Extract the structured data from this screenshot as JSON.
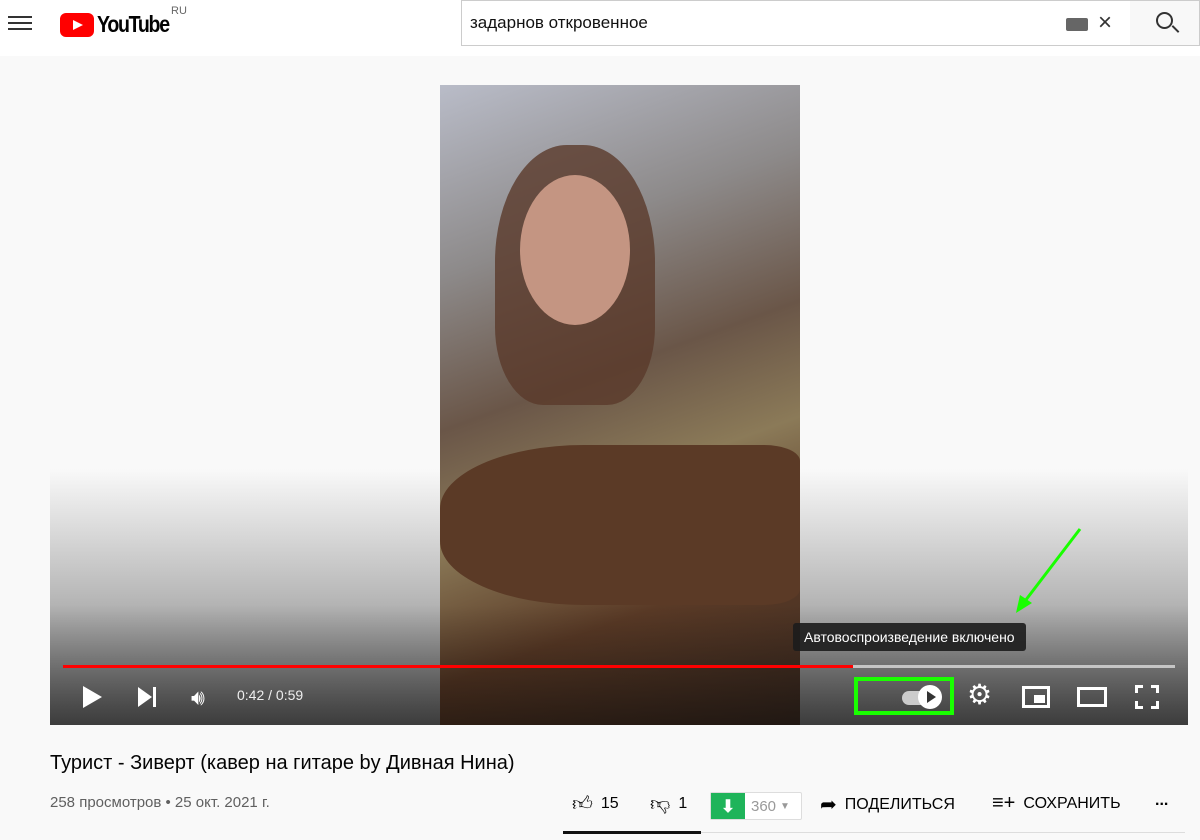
{
  "header": {
    "logo_text": "YouTube",
    "region": "RU",
    "search_value": "задарнов откровенное",
    "icons": [
      "menu-icon",
      "keyboard-icon",
      "close-icon",
      "search-icon"
    ]
  },
  "player": {
    "current_time": "0:42",
    "duration": "0:59",
    "time_display": "0:42 / 0:59",
    "progress_percent": 71,
    "tooltip": "Автовоспроизведение включено",
    "autoplay_on": true,
    "highlight_color": "#19ff00",
    "progress_color": "#ff0000"
  },
  "video": {
    "title": "Турист - Зиверт (кавер на гитаре by Дивная Нина)",
    "meta": "258 просмотров • 25 окт. 2021 г."
  },
  "actions": {
    "likes": "15",
    "dislikes": "1",
    "download_count": "360",
    "share": "ПОДЕЛИТЬСЯ",
    "save": "СОХРАНИТЬ",
    "more": "..."
  }
}
